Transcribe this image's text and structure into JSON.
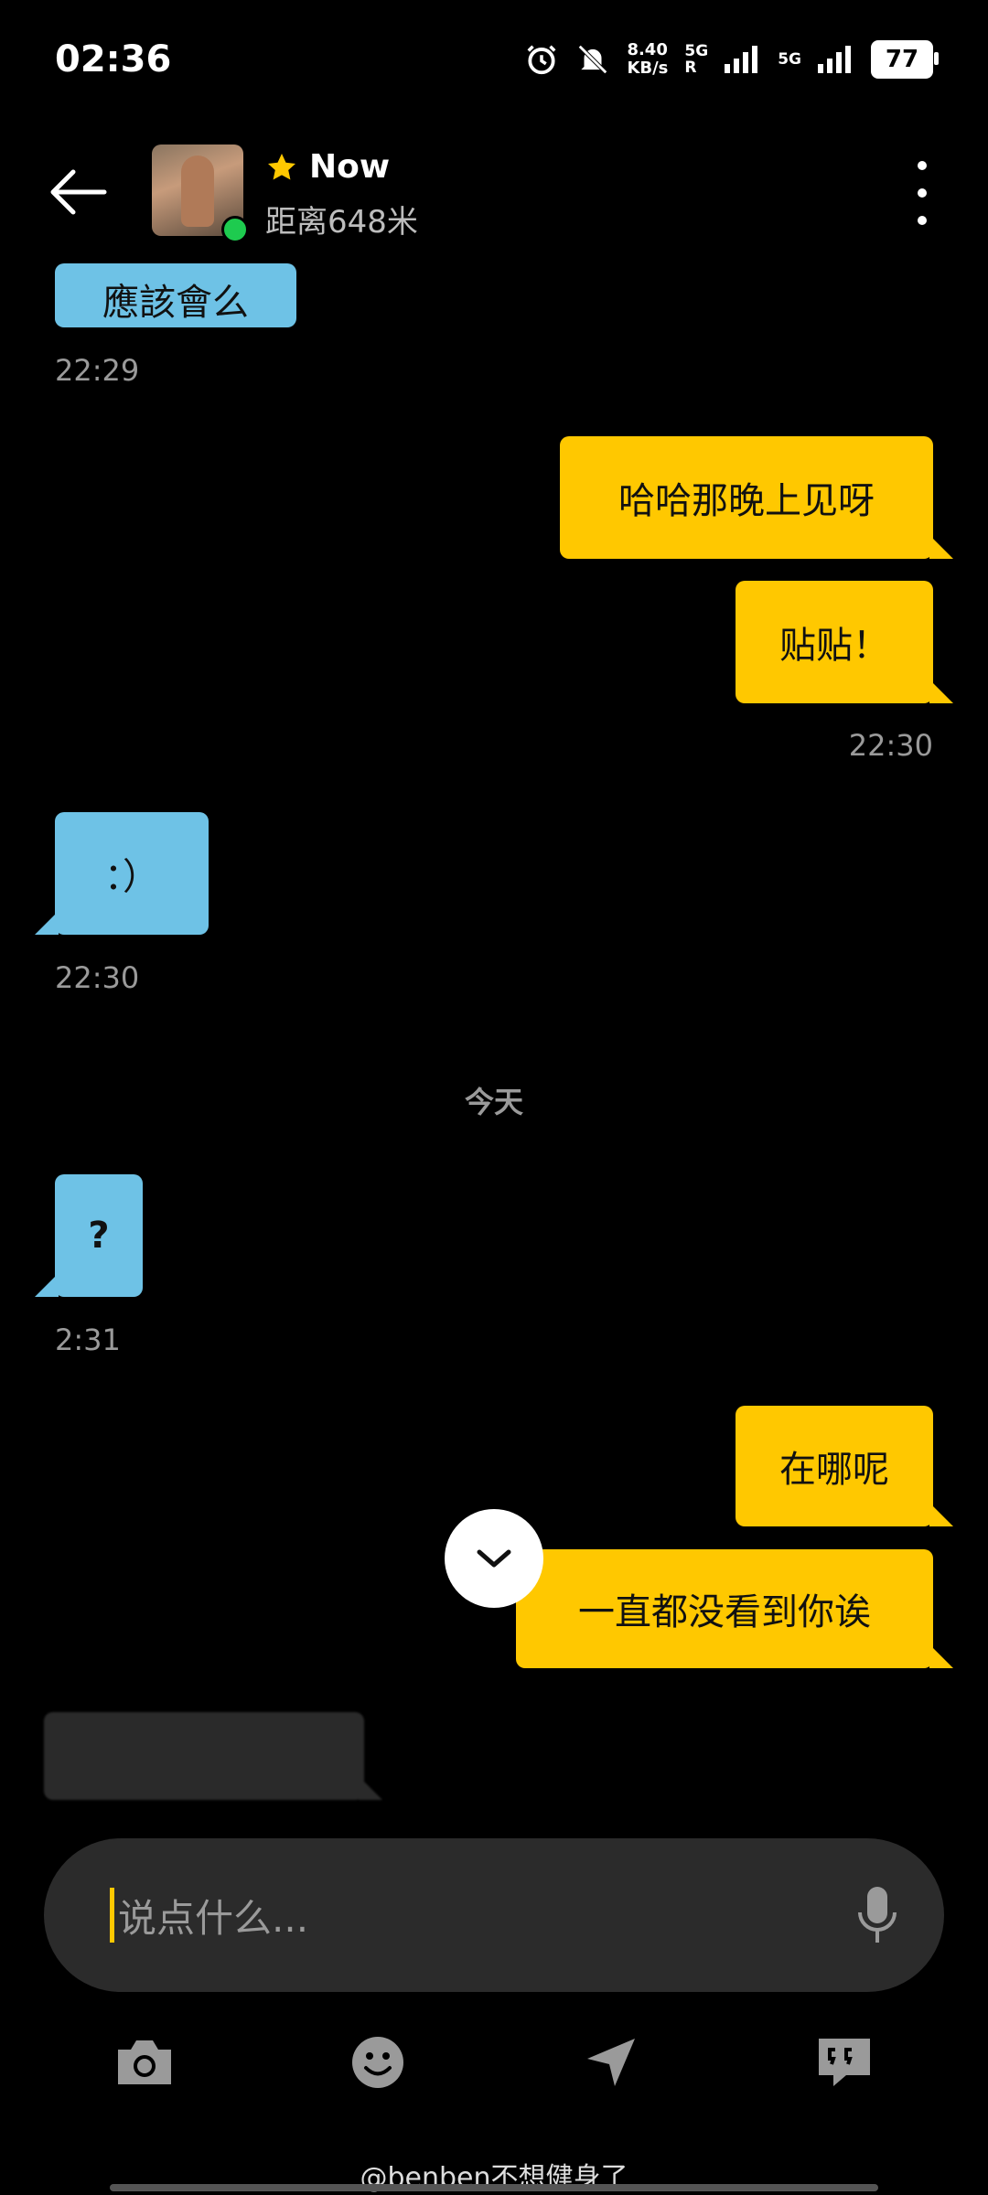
{
  "status_bar": {
    "time": "02:36",
    "net_speed": "8.40",
    "net_unit": "KB/s",
    "sig1": "5G",
    "sig1_sub": "R",
    "sig2": "5G",
    "battery": "77"
  },
  "header": {
    "name": "Now",
    "distance": "距离648米"
  },
  "messages": {
    "partial_in": "應該會么",
    "t1": "22:29",
    "out1": "哈哈那晚上见呀",
    "out2": "贴贴！",
    "t2": "22:30",
    "in2": "：）",
    "t3": "22:30",
    "day": "今天",
    "in3": "?",
    "t4": "2:31",
    "out3": "在哪呢",
    "out4": "一直都没看到你诶"
  },
  "input": {
    "placeholder": "说点什么..."
  },
  "toolbar": {
    "icons": [
      "camera-icon",
      "emoji-icon",
      "location-send-icon",
      "quote-icon"
    ]
  },
  "watermark": "@benben不想健身了",
  "colors": {
    "incoming": "#6ec2e6",
    "outgoing": "#ffc800",
    "background": "#000000"
  }
}
